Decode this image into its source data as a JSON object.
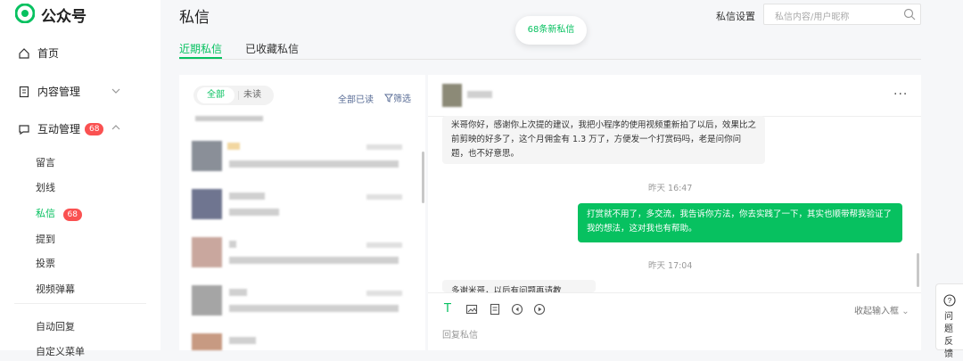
{
  "app": {
    "name": "公众号"
  },
  "sidebar": {
    "home": "首页",
    "content": "内容管理",
    "interaction": "互动管理",
    "interaction_badge": "68",
    "subitems": [
      "留言",
      "划线",
      "私信",
      "提到",
      "投票",
      "视频弹幕"
    ],
    "private_badge": "68",
    "auto_reply": "自动回复",
    "custom_menu": "自定义菜单"
  },
  "header": {
    "title": "私信",
    "tabs": [
      "近期私信",
      "已收藏私信"
    ],
    "settings": "私信设置",
    "search_placeholder": "私信内容/用户昵称",
    "new_messages": "68条新私信"
  },
  "list": {
    "filter_all": "全部",
    "filter_unread": "未读",
    "mark_all_read": "全部已读",
    "filter": "筛选"
  },
  "chat": {
    "msg1": "米哥你好，感谢你上次提的建议，我把小程序的使用视频重新拍了以后，效果比之前剪映的好多了，这个月佣金有 1.3 万了，方便发一个打赏码吗，老是问你问题，也不好意思。",
    "time1": "昨天 16:47",
    "msg2": "打赏就不用了，多交流，我告诉你方法，你去实践了一下，其实也顺带帮我验证了我的想法，这对我也有帮助。",
    "time2": "昨天 17:04",
    "msg3": "多谢米哥，以后有问题再请教",
    "collapse": "收起输入框",
    "reply_placeholder": "回复私信"
  },
  "feedback": {
    "label": "问题反馈"
  },
  "colors": {
    "accent": "#07c160",
    "badge": "#fa5151",
    "link": "#576b95"
  }
}
